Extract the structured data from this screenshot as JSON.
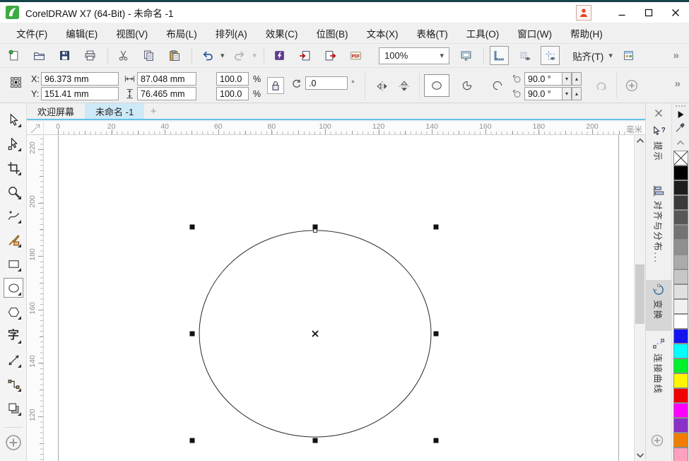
{
  "window": {
    "title": "CorelDRAW X7 (64-Bit) - 未命名 -1",
    "controls": [
      {
        "name": "minimize-button",
        "icon": "minimize-icon"
      },
      {
        "name": "maximize-button",
        "icon": "maximize-icon"
      },
      {
        "name": "close-button",
        "icon": "close-icon"
      }
    ],
    "account_icon": "account-icon",
    "logo_icon": "coreldraw-logo"
  },
  "glyphs": {
    "caret_down": "▾",
    "spin_down": "▾",
    "spin_up": "▴",
    "overflow": "»",
    "new_tab": "+"
  },
  "menu_bar": {
    "items": [
      "文件(F)",
      "编辑(E)",
      "视图(V)",
      "布局(L)",
      "排列(A)",
      "效果(C)",
      "位图(B)",
      "文本(X)",
      "表格(T)",
      "工具(O)",
      "窗口(W)",
      "帮助(H)"
    ]
  },
  "standard_toolbar": {
    "zoom_combo_value": "100%",
    "snap_label": "贴齐(T)",
    "items": [
      {
        "type": "button",
        "name": "new-document"
      },
      {
        "type": "button",
        "name": "open"
      },
      {
        "type": "button",
        "name": "save"
      },
      {
        "type": "button",
        "name": "print"
      },
      {
        "type": "sep"
      },
      {
        "type": "button",
        "name": "cut"
      },
      {
        "type": "button",
        "name": "copy"
      },
      {
        "type": "button",
        "name": "paste"
      },
      {
        "type": "sep"
      },
      {
        "type": "button",
        "name": "undo"
      },
      {
        "type": "caret",
        "name": "undo-dropdown"
      },
      {
        "type": "button",
        "name": "redo",
        "disabled": true
      },
      {
        "type": "caret",
        "name": "redo-dropdown",
        "disabled": true
      },
      {
        "type": "sep"
      },
      {
        "type": "button",
        "name": "application-launcher"
      },
      {
        "type": "button",
        "name": "import"
      },
      {
        "type": "button",
        "name": "export"
      },
      {
        "type": "button",
        "name": "pdf-publish"
      },
      {
        "type": "combo",
        "name": "zoom-levels"
      },
      {
        "type": "button",
        "name": "full-screen-preview"
      },
      {
        "type": "sep"
      },
      {
        "type": "button",
        "name": "show-rulers",
        "pressed": true
      },
      {
        "type": "button",
        "name": "show-grid"
      },
      {
        "type": "button",
        "name": "show-guidelines",
        "pressed": true
      },
      {
        "type": "snap"
      },
      {
        "type": "button",
        "name": "options"
      },
      {
        "type": "spacer"
      },
      {
        "type": "overflow"
      }
    ]
  },
  "property_bar": {
    "x_label": "X:",
    "y_label": "Y:",
    "x_value": "96.373 mm",
    "y_value": "151.41 mm",
    "width_value": "87.048 mm",
    "height_value": "76.465 mm",
    "scale_w": "100.0",
    "scale_h": "100.0",
    "percent": "%",
    "rotation_value": ".0",
    "degree_symbol": "°",
    "start_angle": "90.0 °",
    "end_angle": "90.0 °"
  },
  "tabs": {
    "items": [
      {
        "label": "欢迎屏幕",
        "active": false
      },
      {
        "label": "未命名 -1",
        "active": true
      }
    ]
  },
  "rulers": {
    "unit": "毫米",
    "h_labels": [
      0,
      20,
      40,
      60,
      80,
      100,
      120,
      140,
      160,
      180,
      200
    ],
    "v_labels": [
      220,
      200,
      180,
      160,
      140,
      120
    ]
  },
  "toolbox": {
    "tools": [
      {
        "name": "pick-tool"
      },
      {
        "name": "shape-tool"
      },
      {
        "name": "crop-tool"
      },
      {
        "name": "zoom-tool"
      },
      {
        "name": "freehand-tool"
      },
      {
        "name": "artistic-media-tool"
      },
      {
        "name": "rectangle-tool"
      },
      {
        "name": "ellipse-tool",
        "selected": true
      },
      {
        "name": "polygon-tool"
      },
      {
        "name": "text-tool",
        "glyph": "字"
      },
      {
        "name": "dimension-tool"
      },
      {
        "name": "connector-tool"
      },
      {
        "name": "interactive-effects-tool"
      }
    ]
  },
  "dockers": {
    "tabs": [
      {
        "label": "提示",
        "icon": "hints-icon",
        "active": false
      },
      {
        "label": "对齐与分布...",
        "icon": "align-distribute-icon",
        "active": false
      },
      {
        "label": "变换",
        "icon": "transform-icon",
        "active": true
      },
      {
        "label": "连接曲线",
        "icon": "connect-curves-icon",
        "active": false
      }
    ]
  },
  "palette": {
    "colors": [
      {
        "name": "no-fill",
        "hex": "none"
      },
      {
        "name": "black",
        "hex": "#000000"
      },
      {
        "name": "90-black",
        "hex": "#1d1d1d"
      },
      {
        "name": "80-black",
        "hex": "#3a3a3a"
      },
      {
        "name": "70-black",
        "hex": "#575757"
      },
      {
        "name": "60-black",
        "hex": "#737373"
      },
      {
        "name": "50-black",
        "hex": "#8f8f8f"
      },
      {
        "name": "40-black",
        "hex": "#ababab"
      },
      {
        "name": "30-black",
        "hex": "#c7c7c7"
      },
      {
        "name": "20-black",
        "hex": "#e0e0e0"
      },
      {
        "name": "10-black",
        "hex": "#f0f0f0"
      },
      {
        "name": "white",
        "hex": "#ffffff"
      },
      {
        "name": "blue",
        "hex": "#1414f0"
      },
      {
        "name": "cyan",
        "hex": "#00ffff"
      },
      {
        "name": "green",
        "hex": "#00f02d"
      },
      {
        "name": "yellow",
        "hex": "#fff500"
      },
      {
        "name": "red",
        "hex": "#f00000"
      },
      {
        "name": "magenta",
        "hex": "#ff00ff"
      },
      {
        "name": "purple",
        "hex": "#8a30c8"
      },
      {
        "name": "orange",
        "hex": "#f07d00"
      },
      {
        "name": "pink",
        "hex": "#ffa0be"
      }
    ]
  }
}
